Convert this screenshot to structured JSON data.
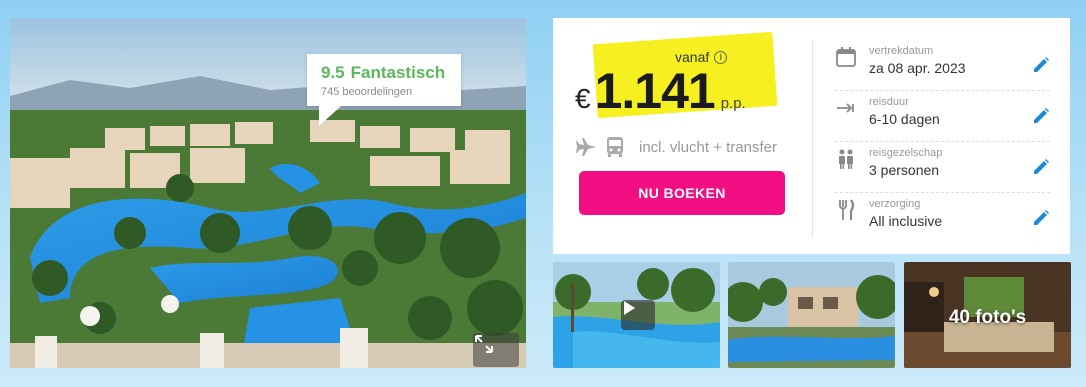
{
  "rating": {
    "score": "9.5",
    "label": "Fantastisch",
    "reviews": "745 beoordelingen"
  },
  "price": {
    "prefix": "vanaf",
    "currency": "€",
    "amount": "1.141",
    "suffix": "p.p.",
    "includes": "incl. vlucht + transfer"
  },
  "book_button": "NU BOEKEN",
  "details": [
    {
      "label": "vertrekdatum",
      "value": "za 08 apr. 2023",
      "icon": "calendar-icon"
    },
    {
      "label": "reisduur",
      "value": "6-10 dagen",
      "icon": "duration-icon"
    },
    {
      "label": "reisgezelschap",
      "value": "3 personen",
      "icon": "people-icon"
    },
    {
      "label": "verzorging",
      "value": "All inclusive",
      "icon": "cutlery-icon"
    }
  ],
  "gallery": {
    "photo_count": "40 foto's"
  },
  "colors": {
    "accent_pink": "#f20f84",
    "rating_green": "#5cb85c",
    "price_highlight": "#f6f020",
    "edit_blue": "#1a8ad6"
  }
}
